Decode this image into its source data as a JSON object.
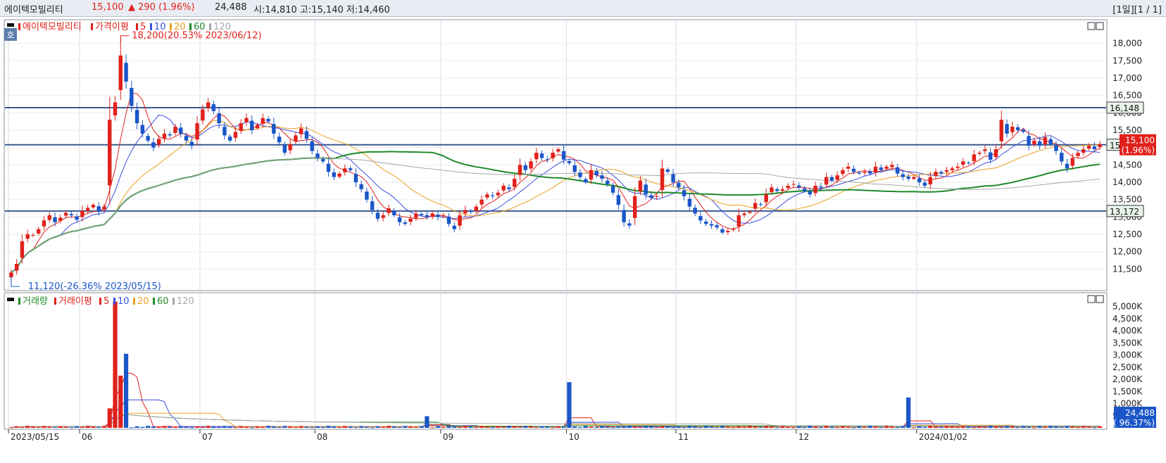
{
  "header": {
    "stock_name": "에이텍모빌리티",
    "price": "15,100",
    "change": "▲ 290 (1.96%)",
    "volume": "24,488",
    "ohl": "시:14,810 고:15,140 저:14,460",
    "period": "[1일][1 / 1]"
  },
  "colors": {
    "up": "#e0211b",
    "down": "#1a56c8",
    "ma5": "#e0211b",
    "ma10": "#3a4fe0",
    "ma20": "#e8a020",
    "ma60": "#1f8a2a",
    "ma120": "#a8a8a8",
    "level": "#3a5a90"
  },
  "chart_data": [
    {
      "type": "candlestick",
      "legend": [
        {
          "label": "에이텍모빌리티",
          "color": "#e0211b"
        },
        {
          "label": "가격이평",
          "color": "#e0211b"
        },
        {
          "label": "5",
          "color": "#e0211b"
        },
        {
          "label": "10",
          "color": "#3a4fe0"
        },
        {
          "label": "20",
          "color": "#e8a020"
        },
        {
          "label": "60",
          "color": "#1f8a2a"
        },
        {
          "label": "120",
          "color": "#a8a8a8"
        }
      ],
      "y_ticks": [
        "11,500",
        "12,000",
        "12,500",
        "13,000",
        "13,500",
        "14,000",
        "14,500",
        "15,000",
        "15,500",
        "16,000",
        "16,500",
        "17,000",
        "17,500",
        "18,000"
      ],
      "ylim": [
        10900,
        18600
      ],
      "x_ticks": [
        {
          "label": "2023/05/15",
          "date": "2023-05-15"
        },
        {
          "label": "06",
          "date": "2023-06-01"
        },
        {
          "label": "07",
          "date": "2023-07-03"
        },
        {
          "label": "08",
          "date": "2023-08-01"
        },
        {
          "label": "09",
          "date": "2023-09-01"
        },
        {
          "label": "10",
          "date": "2023-10-04"
        },
        {
          "label": "11",
          "date": "2023-11-01"
        },
        {
          "label": "12",
          "date": "2023-12-01"
        },
        {
          "label": "2024/01/02",
          "date": "2024-01-02"
        }
      ],
      "horizontal_levels": [
        {
          "label": "16,148",
          "value": 16148
        },
        {
          "label": "15,079",
          "value": 15079
        },
        {
          "label": "13,172",
          "value": 13172
        }
      ],
      "current_price_badge": {
        "label": "15,100",
        "sub": "(1.96%)",
        "value": 15100
      },
      "annotations": [
        {
          "label": "18,200(20.53% 2023/06/12)",
          "date": "2023-06-12",
          "value": 18200
        },
        {
          "label": "11,120(-26.36% 2023/05/15)",
          "date": "2023-05-15",
          "value": 11120
        }
      ],
      "start_date": "2023-05-15",
      "closes": [
        11400,
        11650,
        12300,
        12500,
        12480,
        12650,
        12900,
        13050,
        12850,
        12980,
        13120,
        13050,
        12920,
        13180,
        13260,
        13350,
        13150,
        13300,
        15800,
        16300,
        17650,
        16900,
        16200,
        15700,
        15400,
        15200,
        15000,
        15250,
        15400,
        15350,
        15600,
        15400,
        15200,
        15050,
        15700,
        16100,
        16300,
        16050,
        15700,
        15350,
        15200,
        15450,
        15700,
        15850,
        15500,
        15650,
        15850,
        15750,
        15400,
        15150,
        14850,
        15100,
        15350,
        15550,
        15250,
        14900,
        14700,
        14600,
        14300,
        14150,
        14250,
        14400,
        14350,
        14000,
        13800,
        13500,
        13200,
        12950,
        13050,
        13250,
        13050,
        12850,
        12800,
        12950,
        13100,
        13050,
        13000,
        13100,
        13000,
        13050,
        12800,
        12650,
        13050,
        13200,
        13150,
        13300,
        13500,
        13650,
        13600,
        13700,
        13900,
        13800,
        14100,
        14500,
        14350,
        14600,
        14850,
        14700,
        14650,
        14850,
        14950,
        14650,
        14550,
        14300,
        14150,
        14000,
        14350,
        14200,
        14100,
        13950,
        13700,
        13350,
        12850,
        12750,
        13600,
        14050,
        13650,
        13550,
        13600,
        14400,
        14300,
        14000,
        13850,
        13600,
        13300,
        13100,
        12900,
        12800,
        12750,
        12700,
        12550,
        12600,
        12650,
        13050,
        13100,
        13150,
        13400,
        13350,
        13650,
        13850,
        13750,
        13800,
        13900,
        13950,
        13850,
        13750,
        13650,
        13900,
        13850,
        14150,
        14050,
        14200,
        14350,
        14450,
        14300,
        14250,
        14300,
        14250,
        14450,
        14350,
        14450,
        14500,
        14250,
        14150,
        14100,
        14150,
        14000,
        13900,
        14150,
        14300,
        14250,
        14350,
        14400,
        14450,
        14600,
        14550,
        14800,
        14850,
        14950,
        14650,
        14950,
        15800,
        15400,
        15600,
        15500,
        15450,
        15050,
        15200,
        15050,
        15300,
        15100,
        14900,
        14600,
        14400,
        14700,
        14850,
        14950,
        15050,
        14950,
        15100
      ],
      "ma_series": [
        "5",
        "10",
        "20",
        "60",
        "120"
      ],
      "volume_panel": {
        "legend": [
          {
            "label": "거래량",
            "color": "#1f8a2a"
          },
          {
            "label": "거래이평",
            "color": "#e0211b"
          },
          {
            "label": "5",
            "color": "#e0211b"
          },
          {
            "label": "10",
            "color": "#3a4fe0"
          },
          {
            "label": "20",
            "color": "#e8a020"
          },
          {
            "label": "60",
            "color": "#1f8a2a"
          },
          {
            "label": "120",
            "color": "#a8a8a8"
          }
        ],
        "y_ticks": [
          "500K",
          "1,000K",
          "1,500K",
          "2,000K",
          "2,500K",
          "3,000K",
          "3,500K",
          "4,000K",
          "4,500K",
          "5,000K"
        ],
        "ylim_k": [
          0,
          5450
        ],
        "current_badge": {
          "label": "24,488",
          "sub": "( 96.37%)"
        },
        "spikes_k": [
          {
            "date": "2023-06-08",
            "value": 800
          },
          {
            "date": "2023-06-09",
            "value": 5200
          },
          {
            "date": "2023-06-12",
            "value": 2150
          },
          {
            "date": "2023-06-13",
            "value": 3050
          },
          {
            "date": "2023-08-29",
            "value": 480
          },
          {
            "date": "2023-10-04",
            "value": 1880
          },
          {
            "date": "2023-12-29",
            "value": 1250
          }
        ]
      }
    }
  ]
}
